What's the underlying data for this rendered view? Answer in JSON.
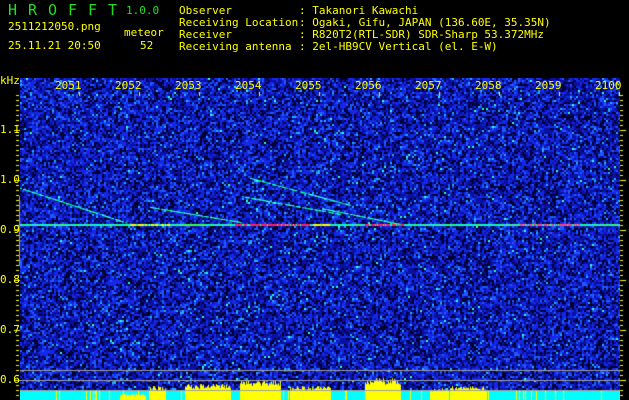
{
  "app": {
    "name_letters": [
      "H",
      "R",
      "O",
      "F",
      "F",
      "T"
    ],
    "version": "1.0.0"
  },
  "file": {
    "name": "2511212050.png",
    "datetime": "25.11.21 20:50"
  },
  "meteor": {
    "label": "meteor",
    "count": "52"
  },
  "info": [
    {
      "label": "Observer",
      "value": "Takanori Kawachi"
    },
    {
      "label": "Receiving Location",
      "value": "Ogaki, Gifu, JAPAN (136.60E, 35.35N)"
    },
    {
      "label": "Receiver",
      "value": "R820T2(RTL-SDR) SDR-Sharp 53.372MHz"
    },
    {
      "label": "Receiving antenna",
      "value": "2el-HB9CV Vertical (el. E-W)"
    }
  ],
  "spectrogram": {
    "freq_unit": "kHz",
    "freq_ticks": [
      "1.1",
      "1.0",
      "0.9",
      "0.8",
      "0.7",
      "0.6"
    ],
    "freq_range_khz": [
      0.565,
      1.205
    ],
    "time_ticks": [
      "2051",
      "2052",
      "2053",
      "2054",
      "2055",
      "2056",
      "2057",
      "2058",
      "2059",
      "2100"
    ],
    "carrier_khz": 0.912,
    "colors": {
      "background": "#000080",
      "noise": "#1e3cff",
      "signal": "#00ff66",
      "peak": "#ff2060",
      "profile": "#ffff00",
      "baseline": "#00ffff",
      "label": "#ffff00"
    }
  }
}
